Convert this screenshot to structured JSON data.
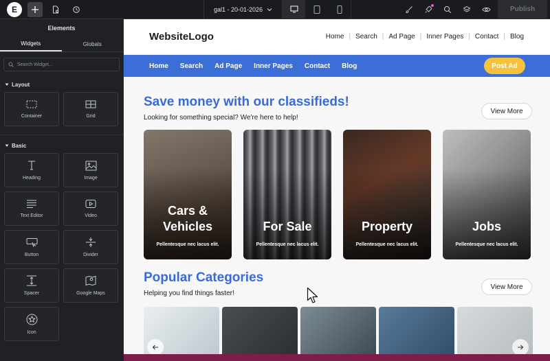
{
  "topbar": {
    "logo": "E",
    "doc_title": "gal1 - 20-01-2026",
    "publish": "Publish",
    "icons": [
      "plus-icon",
      "file-settings-icon",
      "history-icon",
      "desktop-icon",
      "tablet-icon",
      "mobile-icon",
      "brush-icon",
      "rocket-icon",
      "search-icon",
      "layers-icon",
      "eye-icon"
    ]
  },
  "sidebar": {
    "title": "Elements",
    "tabs": [
      "Widgets",
      "Globals"
    ],
    "search_placeholder": "Search Widget...",
    "layout_label": "Layout",
    "basic_label": "Basic",
    "layout_widgets": [
      "Container",
      "Grid"
    ],
    "basic_widgets": [
      "Heading",
      "Image",
      "Text Editor",
      "Video",
      "Button",
      "Divider",
      "Spacer",
      "Google Maps",
      "Icon"
    ]
  },
  "site": {
    "logo": "WebsiteLogo",
    "nav": [
      "Home",
      "Search",
      "Ad Page",
      "Inner Pages",
      "Contact",
      "Blog"
    ],
    "bar_nav": [
      "Home",
      "Search",
      "Ad Page",
      "Inner Pages",
      "Contact",
      "Blog"
    ],
    "post_ad": "Post Ad",
    "hero": {
      "title": "Save money with our classifieds!",
      "subtitle": "Looking for something special? We're here to help!",
      "view_more": "View More"
    },
    "cards": [
      {
        "title": "Cars &\nVehicles",
        "sub": "Pellentesque nec lacus elit."
      },
      {
        "title": "For Sale",
        "sub": "Pellentesque nec lacus elit."
      },
      {
        "title": "Property",
        "sub": "Pellentesque nec lacus elit."
      },
      {
        "title": "Jobs",
        "sub": "Pellentesque nec lacus elit."
      }
    ],
    "popular": {
      "title": "Popular Categories",
      "subtitle": "Helping you find things faster!",
      "view_more": "View More"
    }
  },
  "colors": {
    "accent_blue": "#3b6ed6",
    "title_blue": "#3a6ad4",
    "post_ad_yellow": "#f5c33b",
    "notice_bar": "#7e1c4c"
  }
}
